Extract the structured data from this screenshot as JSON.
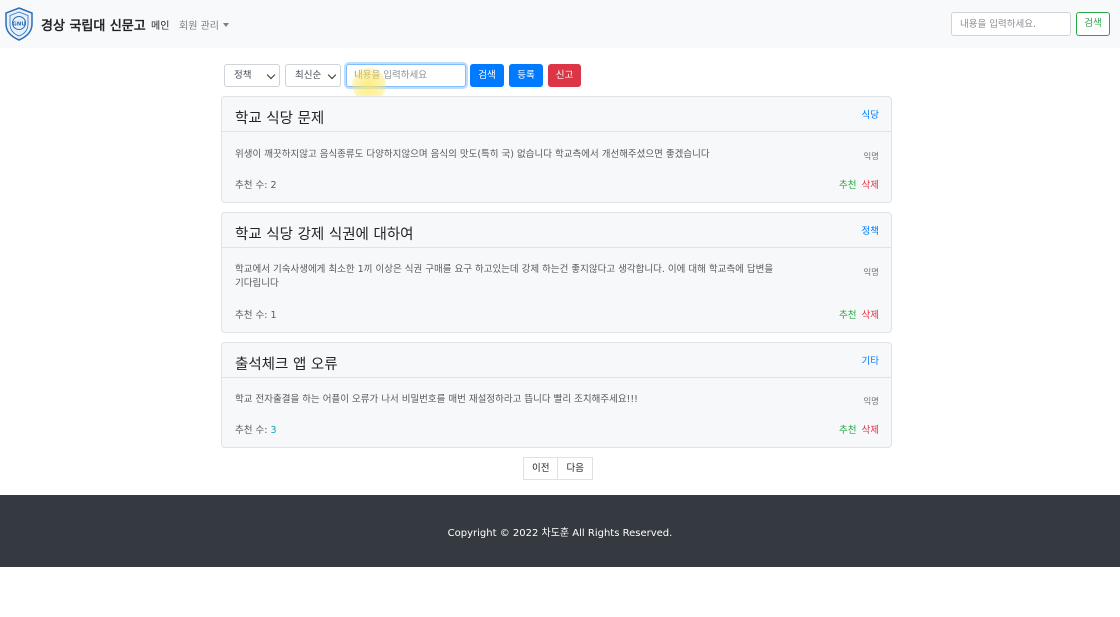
{
  "navbar": {
    "brand": "경상 국립대 신문고",
    "main_label": "메인",
    "members_label": "회원 관리",
    "search_placeholder": "내용을 입력하세요.",
    "search_button": "검색",
    "logo_text": "GNU"
  },
  "toolbar": {
    "category_select": "정책",
    "sort_select": "최신순",
    "input_placeholder": "내용을 입력하세요",
    "search_button": "검색",
    "register_button": "등록",
    "report_button": "신고"
  },
  "posts": [
    {
      "title": "학교 식당 문제",
      "category": "식당",
      "content": "위생이 깨끗하지않고 음식종류도 다양하지않으며 음식의 맛도(특히 국) 없습니다 학교측에서 개선해주셨으면 좋겠습니다",
      "author": "익명",
      "rec_label": "추천 수: ",
      "rec_count": "2",
      "rec_action": "추천",
      "del_action": "삭제"
    },
    {
      "title": "학교 식당 강제 식권에 대하여",
      "category": "정책",
      "content": "학교에서 기숙사생에게 최소한 1끼 이상은 식권 구매를 요구 하고있는데 강제 하는건 좋지않다고 생각합니다. 이에 대해 학교측에 답변을 기다립니다",
      "author": "익명",
      "rec_label": "추천 수: ",
      "rec_count": "1",
      "rec_action": "추천",
      "del_action": "삭제"
    },
    {
      "title": "출석체크 앱 오류",
      "category": "기타",
      "content": "학교 전자출결을 하는 어플이 오류가 나서 비밀번호를 매번 재설정하라고 뜹니다 빨리 조치해주세요!!!",
      "author": "익명",
      "rec_label": "추천 수: ",
      "rec_count": "3",
      "rec_action": "추천",
      "del_action": "삭제"
    }
  ],
  "pagination": {
    "prev": "이전",
    "next": "다음"
  },
  "footer": {
    "text": "Copyright © 2022 차도훈 All Rights Reserved."
  },
  "colors": {
    "primary": "#007bff",
    "success": "#28a745",
    "danger": "#dc3545",
    "footer_bg": "#343a40",
    "navbar_bg": "#f8f9fa"
  }
}
